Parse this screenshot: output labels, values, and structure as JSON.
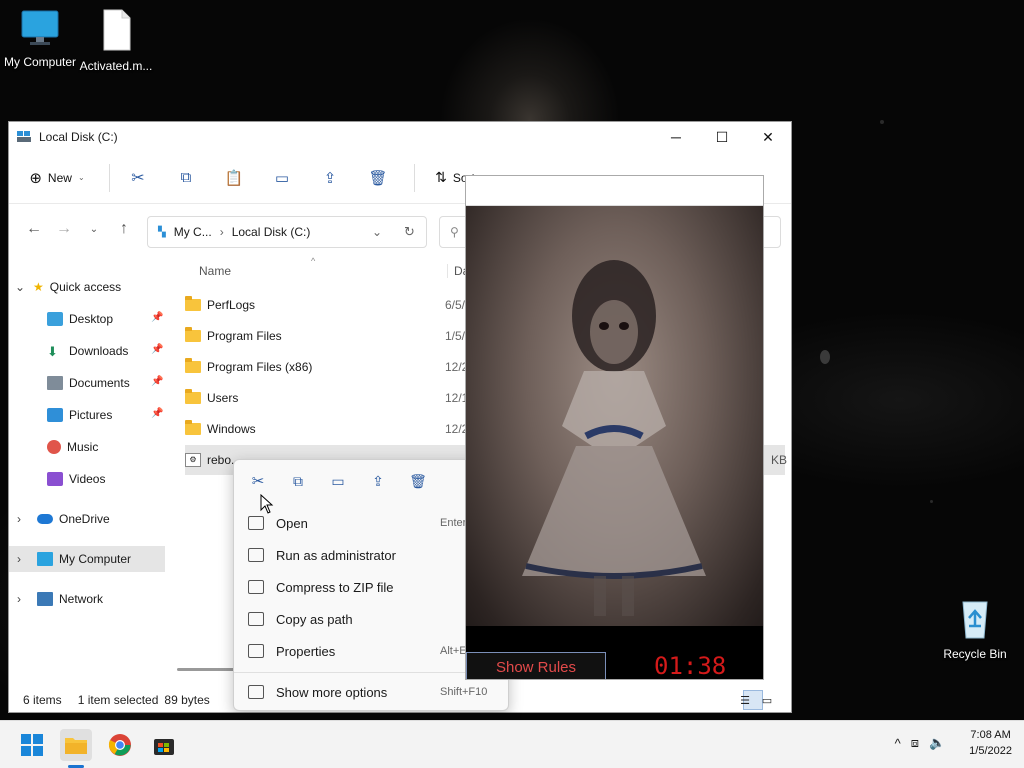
{
  "desktop": {
    "icons": [
      {
        "label": "My Computer",
        "icon": "monitor-icon"
      },
      {
        "label": "Activated.m...",
        "icon": "file-icon"
      },
      {
        "label": "Recycle Bin",
        "icon": "recycle-bin-icon"
      }
    ]
  },
  "explorer": {
    "title": "Local Disk (C:)",
    "toolbar": {
      "new_label": "New",
      "sort_label": "Sort"
    },
    "address": {
      "segments": [
        "My C...",
        "Local Disk (C:)"
      ]
    },
    "columns": {
      "name": "Name",
      "date": "Date"
    },
    "sidebar": {
      "quick_access": "Quick access",
      "items": [
        "Desktop",
        "Downloads",
        "Documents",
        "Pictures",
        "Music",
        "Videos"
      ],
      "onedrive": "OneDrive",
      "my_computer": "My Computer",
      "network": "Network"
    },
    "files": [
      {
        "name": "PerfLogs",
        "date": "6/5/"
      },
      {
        "name": "Program Files",
        "date": "1/5/"
      },
      {
        "name": "Program Files (x86)",
        "date": "12/2"
      },
      {
        "name": "Users",
        "date": "12/1"
      },
      {
        "name": "Windows",
        "date": "12/2"
      },
      {
        "name": "rebo...",
        "date": "",
        "size": "KB"
      }
    ],
    "status": {
      "count": "6 items",
      "selected": "1 item selected",
      "size": "89 bytes"
    }
  },
  "context_menu": {
    "items": [
      {
        "label": "Open",
        "shortcut": "Enter"
      },
      {
        "label": "Run as administrator",
        "shortcut": ""
      },
      {
        "label": "Compress to ZIP file",
        "shortcut": ""
      },
      {
        "label": "Copy as path",
        "shortcut": ""
      },
      {
        "label": "Properties",
        "shortcut": "Alt+Enter"
      },
      {
        "label": "Show more options",
        "shortcut": "Shift+F10"
      }
    ]
  },
  "popup": {
    "rules_label": "Show Rules",
    "timer": "01:38",
    "timer_color": "#d41a1a"
  },
  "taskbar": {
    "time": "7:08 AM",
    "date": "1/5/2022"
  }
}
